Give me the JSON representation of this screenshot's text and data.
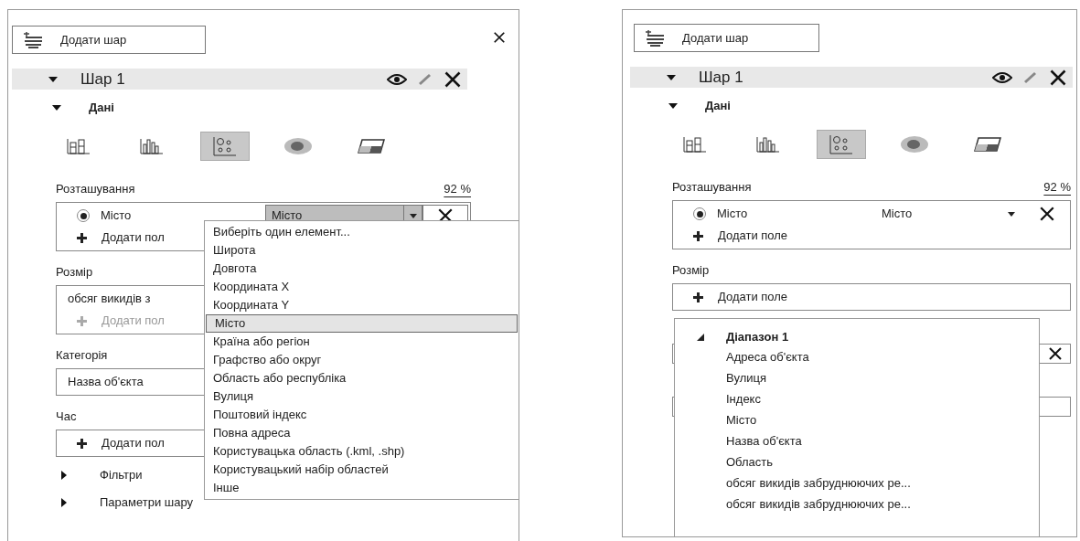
{
  "panels": [
    {
      "add_layer": "Додати шар",
      "closable": true,
      "layer": {
        "title": "Шар 1",
        "expanded": true
      },
      "section": {
        "title": "Дані",
        "expanded": true
      },
      "viz_types": [
        {
          "kind": "stacked-column",
          "selected": false
        },
        {
          "kind": "clustered-column",
          "selected": false
        },
        {
          "kind": "bubble",
          "selected": true
        },
        {
          "kind": "heat-map",
          "selected": false
        },
        {
          "kind": "region",
          "selected": false
        }
      ],
      "groups": [
        {
          "kind": "field-list",
          "label": "Розташування",
          "reading": "92 %",
          "rows": [
            {
              "kind": "radio-field",
              "name": "Місто",
              "selected": true,
              "type": "Місто",
              "open": true
            },
            {
              "kind": "add",
              "text": "Додати пол",
              "disabled": false
            }
          ]
        },
        {
          "kind": "field-list",
          "label": "Розмір",
          "rows": [
            {
              "kind": "value",
              "text": "обсяг викидів з"
            },
            {
              "kind": "add",
              "text": "Додати пол",
              "disabled": true
            }
          ]
        },
        {
          "kind": "field-list",
          "label": "Категорія",
          "rows": [
            {
              "kind": "value",
              "text": "Назва об'єкта"
            }
          ]
        },
        {
          "kind": "field-list",
          "label": "Час",
          "rows": [
            {
              "kind": "add",
              "text": "Додати пол",
              "disabled": false
            }
          ]
        },
        {
          "kind": "expander",
          "label": "Фільтри",
          "expanded": false
        },
        {
          "kind": "expander",
          "label": "Параметри шару",
          "expanded": false
        }
      ],
      "menu": {
        "kind": "list",
        "items": [
          {
            "text": "Виберіть один елемент...",
            "selected": false
          },
          {
            "text": "Широта",
            "selected": false
          },
          {
            "text": "Довгота",
            "selected": false
          },
          {
            "text": "Координата X",
            "selected": false
          },
          {
            "text": "Координата Y",
            "selected": false
          },
          {
            "text": "Місто",
            "selected": true
          },
          {
            "text": "Країна або регіон",
            "selected": false
          },
          {
            "text": "Графство або округ",
            "selected": false
          },
          {
            "text": "Область або республіка",
            "selected": false
          },
          {
            "text": "Вулиця",
            "selected": false
          },
          {
            "text": "Поштовий індекс",
            "selected": false
          },
          {
            "text": "Повна адреса",
            "selected": false
          },
          {
            "text": "Користувацька область (.kml, .shp)",
            "selected": false
          },
          {
            "text": "Користувацький набір областей",
            "selected": false
          },
          {
            "text": "Інше",
            "selected": false
          }
        ]
      }
    },
    {
      "add_layer": "Додати шар",
      "closable": false,
      "layer": {
        "title": "Шар 1",
        "expanded": true
      },
      "section": {
        "title": "Дані",
        "expanded": true
      },
      "viz_types": [
        {
          "kind": "stacked-column",
          "selected": false
        },
        {
          "kind": "clustered-column",
          "selected": false
        },
        {
          "kind": "bubble",
          "selected": true
        },
        {
          "kind": "heat-map",
          "selected": false
        },
        {
          "kind": "region",
          "selected": false
        }
      ],
      "groups": [
        {
          "kind": "field-list",
          "label": "Розташування",
          "reading": "92 %",
          "rows": [
            {
              "kind": "radio-field",
              "name": "Місто",
              "selected": true,
              "type": "Місто",
              "open": false
            },
            {
              "kind": "add",
              "text": "Додати поле",
              "disabled": false
            }
          ]
        },
        {
          "kind": "field-list",
          "label": "Розмір",
          "rows": [
            {
              "kind": "add",
              "text": "Додати поле",
              "disabled": false
            }
          ]
        },
        {
          "kind": "covered",
          "removable": true
        },
        {
          "kind": "covered",
          "removable": false
        }
      ],
      "menu": {
        "kind": "tree",
        "items": [
          {
            "text": "Діапазон 1",
            "expanded": true,
            "children": [
              {
                "text": "Адреса об'єкта"
              },
              {
                "text": "Вулиця"
              },
              {
                "text": "Індекс"
              },
              {
                "text": "Місто"
              },
              {
                "text": "Назва об'єкта"
              },
              {
                "text": "Область"
              },
              {
                "text": "обсяг викидів забруднюючих ре..."
              },
              {
                "text": "обсяг викидів забруднюючих ре..."
              }
            ]
          }
        ]
      }
    }
  ]
}
